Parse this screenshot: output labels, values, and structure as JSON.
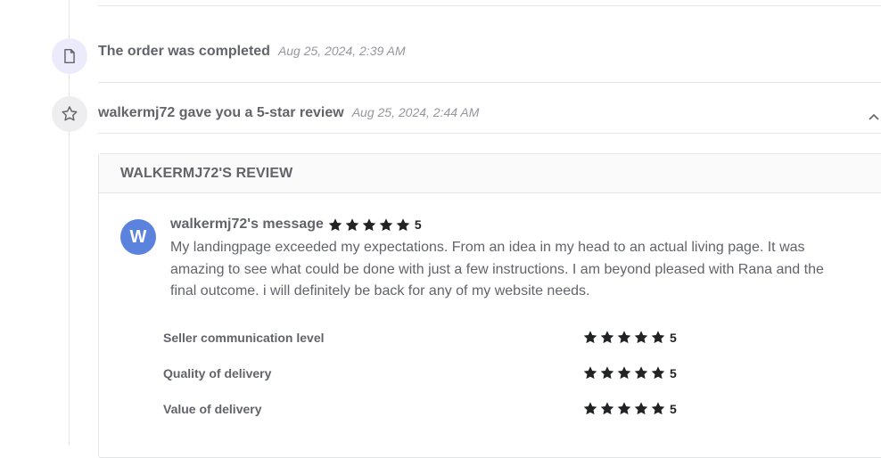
{
  "events": [
    {
      "text": "The order was completed",
      "date": "Aug 25, 2024, 2:39 AM",
      "icon": "document-icon"
    },
    {
      "text": "walkermj72 gave you a 5-star review",
      "date": "Aug 25, 2024, 2:44 AM",
      "icon": "star-outline-icon"
    }
  ],
  "review": {
    "header": "WALKERMJ72'S REVIEW",
    "avatar_letter": "W",
    "message_title": "walkermj72's message",
    "overall_score": "5",
    "overall_stars": 5,
    "message": "My landingpage exceeded my expectations. From an idea in my head to an actual living page. It was amazing to see what could be done with just a few instructions. I am beyond pleased with Rana and the final outcome. i will definitely be back for any of my website needs.",
    "ratings": [
      {
        "label": "Seller communication level",
        "score": "5",
        "stars": 5
      },
      {
        "label": "Quality of delivery",
        "score": "5",
        "stars": 5
      },
      {
        "label": "Value of delivery",
        "score": "5",
        "stars": 5
      }
    ]
  },
  "colors": {
    "avatar": "#5b82dd",
    "event_icon_bg_completed": "#ecebfb",
    "event_icon_bg_review": "#eeeef0",
    "star": "#222325"
  },
  "icons": {
    "collapse": "chevron-up-icon",
    "rating_star": "star-filled-icon"
  }
}
